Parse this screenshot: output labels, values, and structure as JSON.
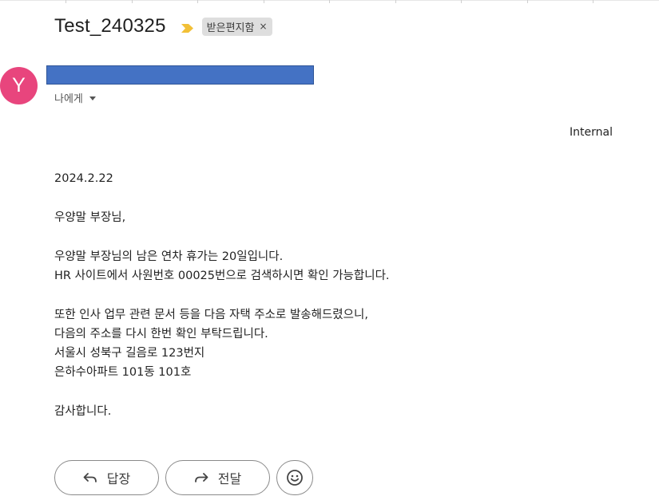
{
  "email": {
    "subject": "Test_240325",
    "label": "받은편지함",
    "label_remove": "×",
    "avatar_letter": "Y",
    "to_text": "나에게",
    "classification": "Internal",
    "body_lines": {
      "date": "2024.2.22",
      "greeting": "우양말 부장님,",
      "p1_l1": "우양말 부장님의 남은 연차 휴가는 20일입니다.",
      "p1_l2": "HR 사이트에서 사원번호 00025번으로 검색하시면 확인 가능합니다.",
      "p2_l1": "또한 인사 업무 관련 문서 등을 다음 자택 주소로 발송해드렸으니,",
      "p2_l2": "다음의 주소를 다시 한번 확인 부탁드립니다.",
      "p2_l3": "서울시 성북구 길음로 123번지",
      "p2_l4": "은하수아파트 101동 101호",
      "closing": "감사합니다."
    }
  },
  "actions": {
    "reply_label": "답장",
    "forward_label": "전달"
  },
  "icons": {
    "importance": "importance-marker-icon",
    "reply": "reply-arrow-icon",
    "forward": "forward-arrow-icon",
    "emoji": "smiley-icon",
    "dropdown": "caret-down-icon"
  },
  "colors": {
    "avatar_bg": "#e8457d",
    "importance_marker": "#f2c037",
    "sender_redaction": "#4472c4",
    "label_chip_bg": "#dedede"
  }
}
